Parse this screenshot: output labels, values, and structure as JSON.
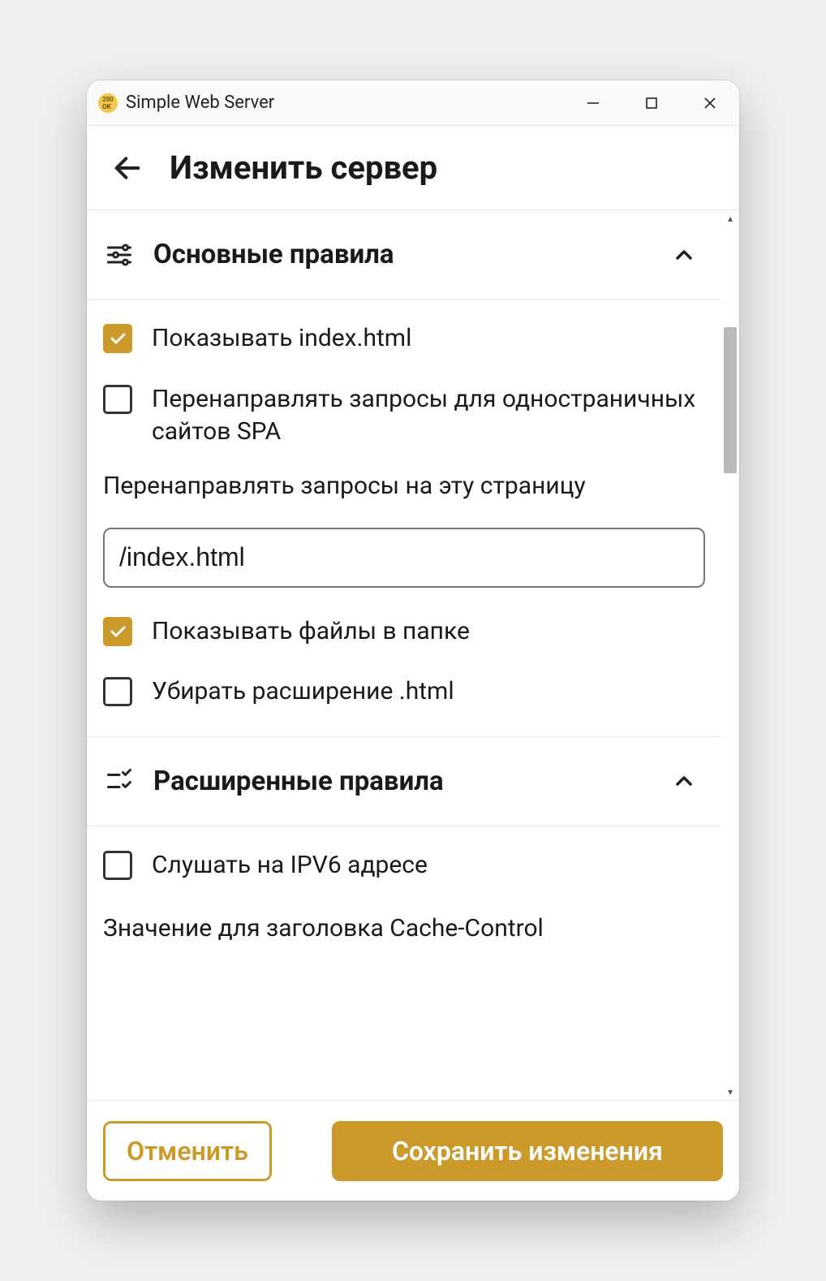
{
  "window": {
    "title": "Simple Web Server"
  },
  "header": {
    "page_title": "Изменить сервер"
  },
  "sections": {
    "basic": {
      "title": "Основные правила",
      "show_index_label": "Показывать index.html",
      "show_index_checked": true,
      "spa_redirect_label": "Перенаправлять запросы для одностраничных сайтов SPA",
      "spa_redirect_checked": false,
      "redirect_field_label": "Перенаправлять запросы на эту страницу",
      "redirect_value": "/index.html",
      "show_files_label": "Показывать файлы в папке",
      "show_files_checked": true,
      "strip_html_label": "Убирать расширение .html",
      "strip_html_checked": false
    },
    "advanced": {
      "title": "Расширенные правила",
      "ipv6_label": "Слушать на IPV6 адресе",
      "ipv6_checked": false,
      "cache_control_label": "Значение для заголовка Cache-Control"
    }
  },
  "footer": {
    "cancel": "Отменить",
    "save": "Сохранить изменения"
  },
  "colors": {
    "accent": "#cc9a2a"
  }
}
